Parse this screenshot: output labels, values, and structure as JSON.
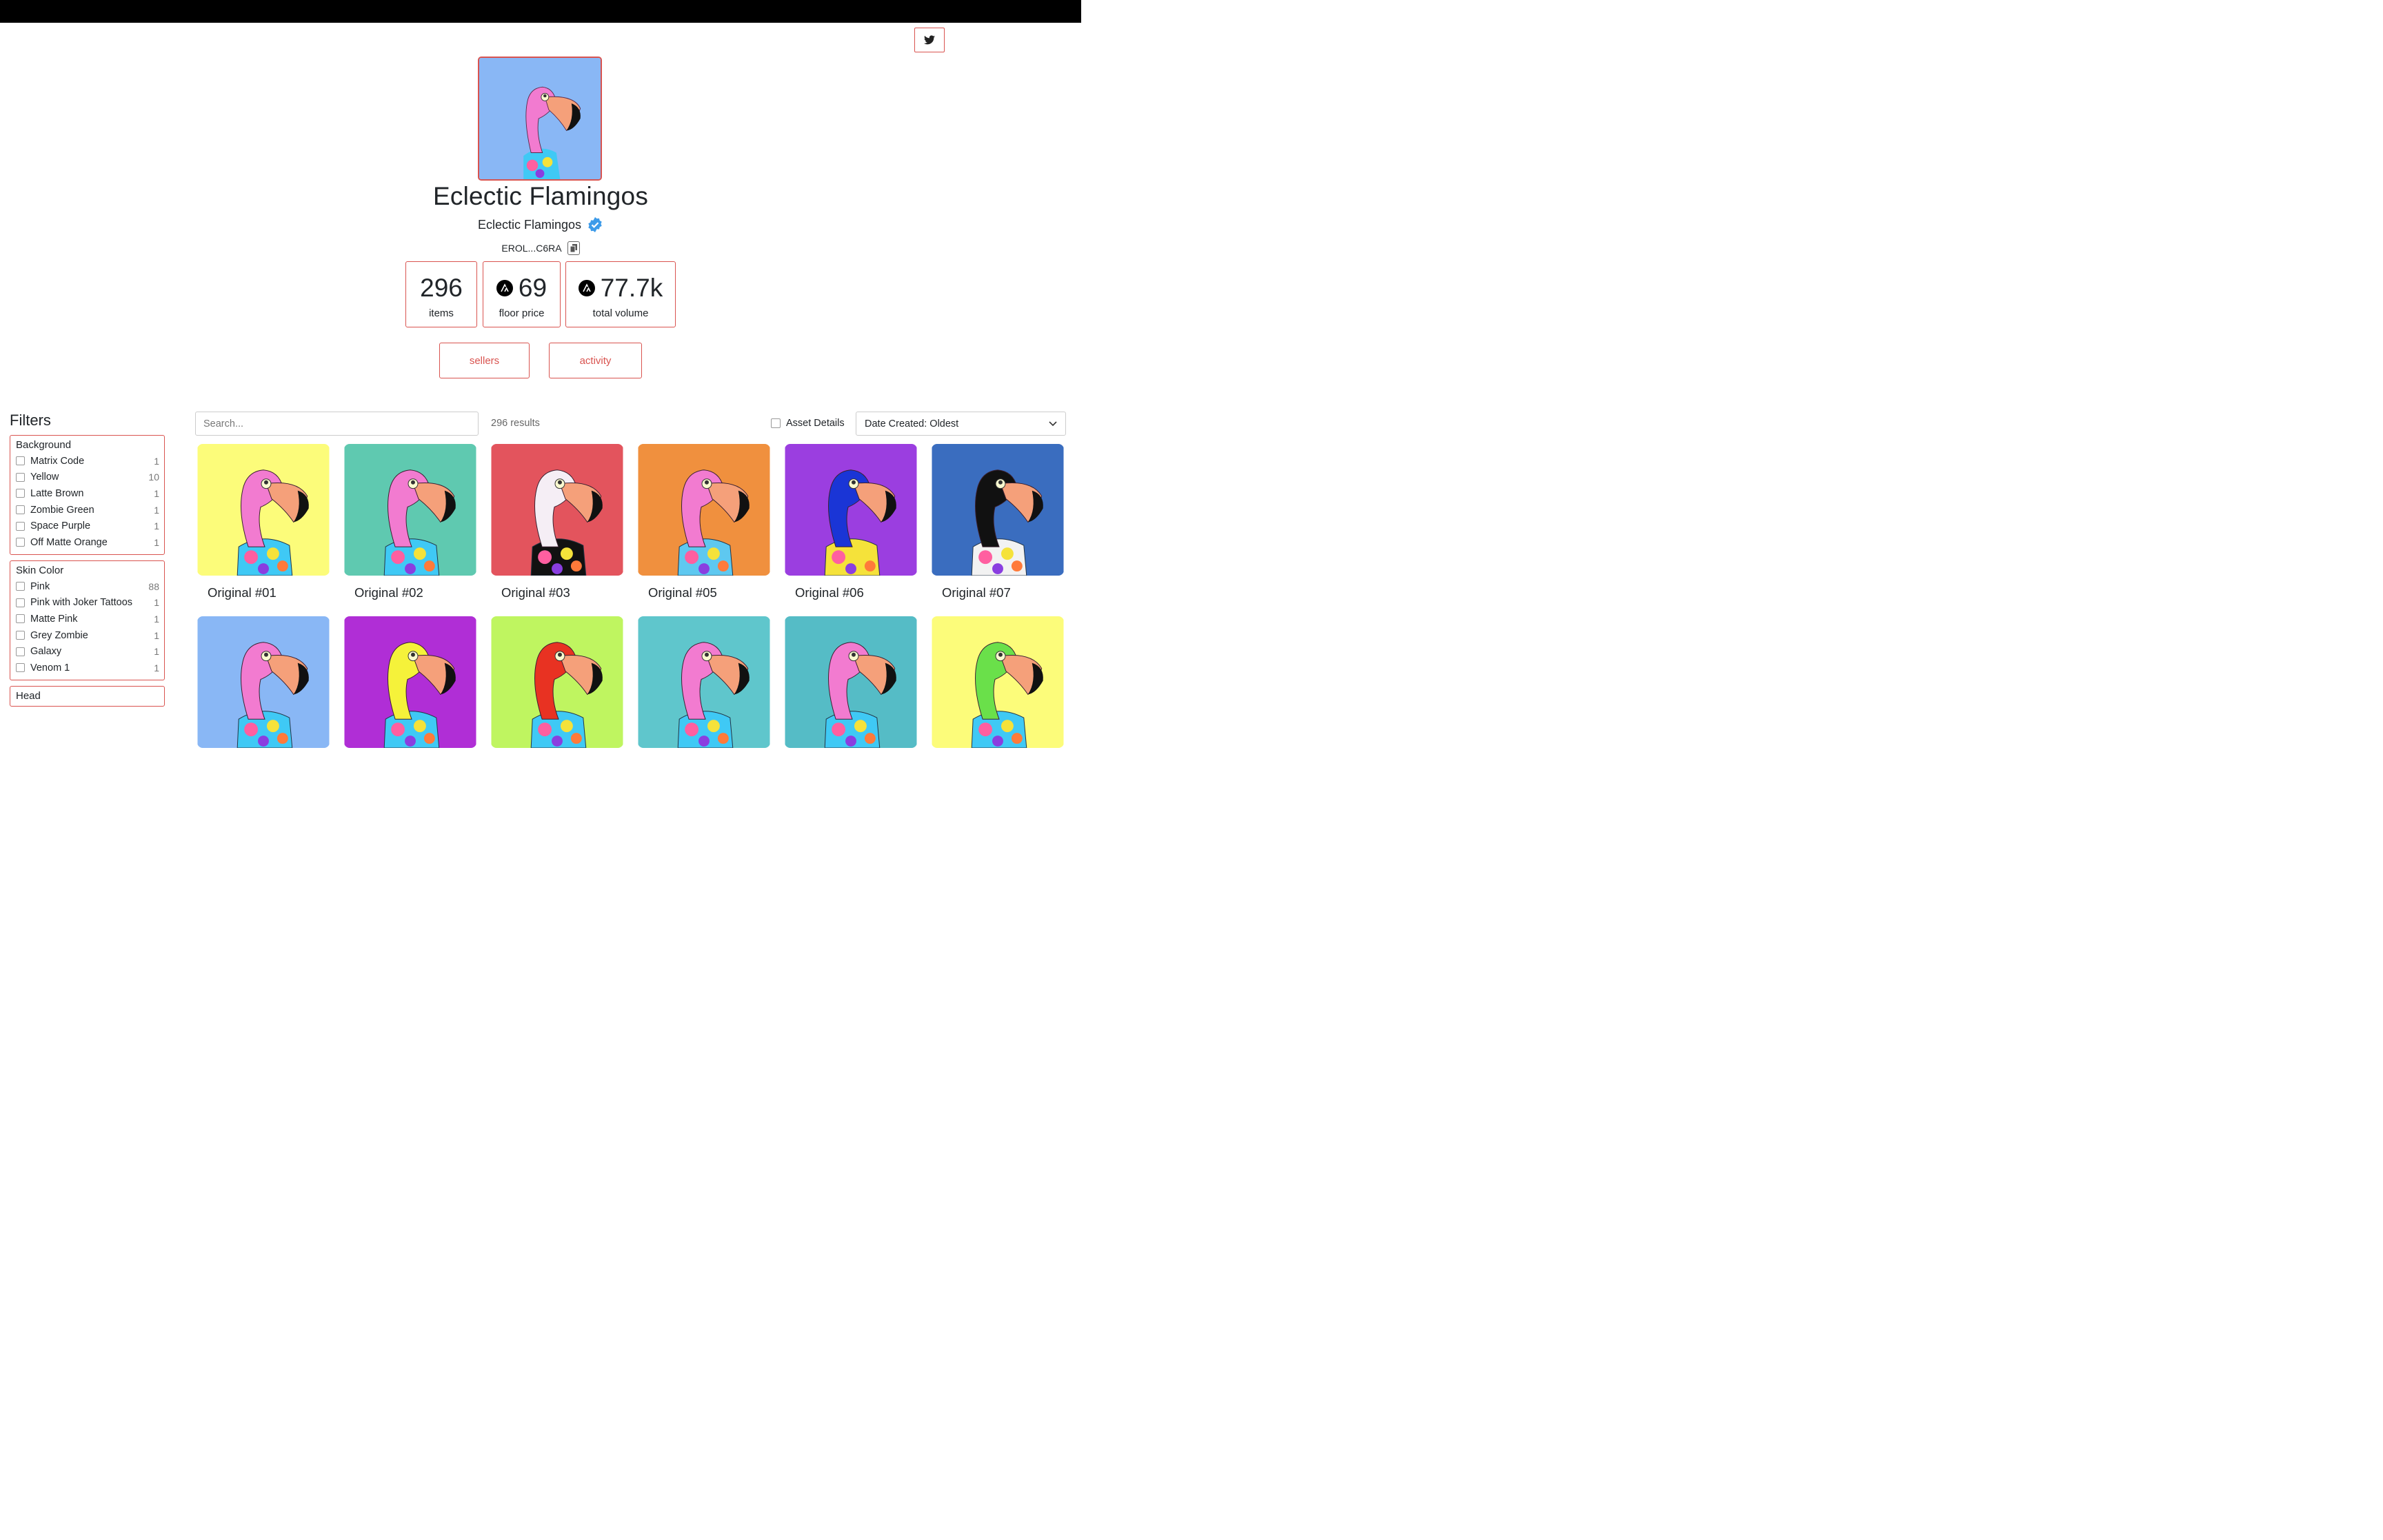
{
  "header": {
    "twitter_icon": "twitter-icon"
  },
  "collection": {
    "title": "Eclectic Flamingos",
    "creator": "Eclectic Flamingos",
    "verified_icon": "verified-badge-icon",
    "address": "EROL...C6RA",
    "avatar_bg": "#89b7f5",
    "accent": "#d9534f"
  },
  "stats": [
    {
      "value": "296",
      "label": "items",
      "icon": ""
    },
    {
      "value": "69",
      "label": "floor price",
      "icon": "algorand-icon"
    },
    {
      "value": "77.7k",
      "label": "total volume",
      "icon": "algorand-icon"
    }
  ],
  "actions": {
    "sellers": "sellers",
    "activity": "activity"
  },
  "filters": {
    "title": "Filters",
    "groups": [
      {
        "name": "Background",
        "options": [
          {
            "label": "Matrix Code",
            "count": "1"
          },
          {
            "label": "Yellow",
            "count": "10"
          },
          {
            "label": "Latte Brown",
            "count": "1"
          },
          {
            "label": "Zombie Green",
            "count": "1"
          },
          {
            "label": "Space Purple",
            "count": "1"
          },
          {
            "label": "Off Matte Orange",
            "count": "1"
          }
        ]
      },
      {
        "name": "Skin Color",
        "options": [
          {
            "label": "Pink",
            "count": "88"
          },
          {
            "label": "Pink with Joker Tattoos",
            "count": "1"
          },
          {
            "label": "Matte Pink",
            "count": "1"
          },
          {
            "label": "Grey Zombie",
            "count": "1"
          },
          {
            "label": "Galaxy",
            "count": "1"
          },
          {
            "label": "Venom 1",
            "count": "1"
          }
        ]
      },
      {
        "name": "Head",
        "options": []
      }
    ]
  },
  "toolbar": {
    "search_placeholder": "Search...",
    "results": "296 results",
    "asset_details": "Asset Details",
    "sort": "Date Created: Oldest"
  },
  "items": [
    {
      "name": "Original #01",
      "bg": "#fcfc7a",
      "skin": "#f27bd0",
      "shirt": "#3fc9f5"
    },
    {
      "name": "Original #02",
      "bg": "#5fc9b0",
      "skin": "#f27bd0",
      "shirt": "#3fc9f5"
    },
    {
      "name": "Original #03",
      "bg": "#e3545d",
      "skin": "#f5eef5",
      "shirt": "#111111"
    },
    {
      "name": "Original #05",
      "bg": "#f0903e",
      "skin": "#f27bd0",
      "shirt": "#5ec8f0"
    },
    {
      "name": "Original #06",
      "bg": "#9b3ee0",
      "skin": "#1a35d6",
      "shirt": "#f5e23a"
    },
    {
      "name": "Original #07",
      "bg": "#3a6dbf",
      "skin": "#111111",
      "shirt": "#f2f2f2"
    },
    {
      "name": "",
      "bg": "#89b7f5",
      "skin": "#f27bd0",
      "shirt": "#3fc9f5"
    },
    {
      "name": "",
      "bg": "#b02ed6",
      "skin": "#f5f23a",
      "shirt": "#3fc9f5"
    },
    {
      "name": "",
      "bg": "#bff560",
      "skin": "#e83222",
      "shirt": "#3fc9f5"
    },
    {
      "name": "",
      "bg": "#5fc6cc",
      "skin": "#f27bd0",
      "shirt": "#3fc9f5"
    },
    {
      "name": "",
      "bg": "#55bcc6",
      "skin": "#f27bd0",
      "shirt": "#3fc9f5"
    },
    {
      "name": "",
      "bg": "#fcfc7a",
      "skin": "#6ae04a",
      "shirt": "#3fc9f5"
    }
  ]
}
